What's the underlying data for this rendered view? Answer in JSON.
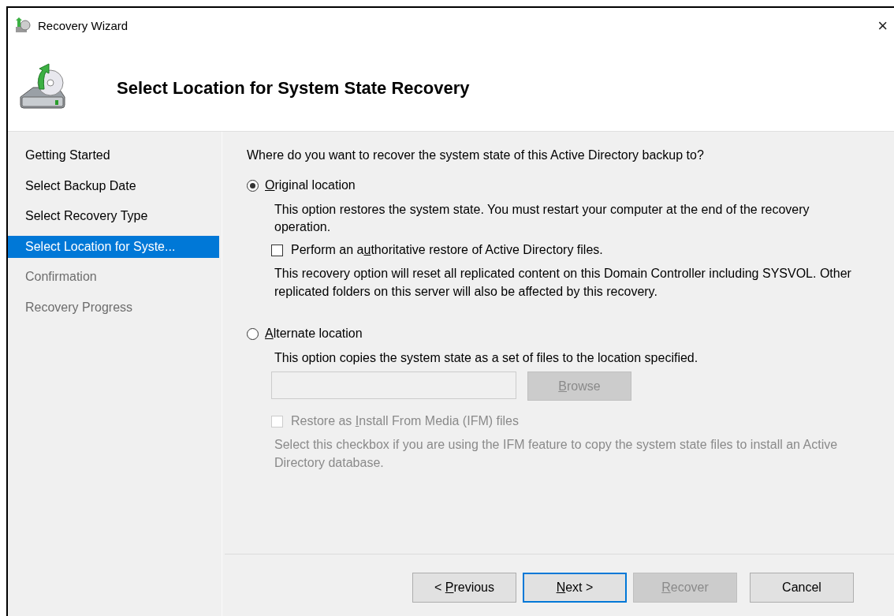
{
  "window": {
    "title": "Recovery Wizard",
    "close": "×"
  },
  "header": {
    "title": "Select Location for System State Recovery"
  },
  "steps": [
    {
      "label": "Getting Started",
      "selected": false,
      "disabled": false
    },
    {
      "label": "Select Backup Date",
      "selected": false,
      "disabled": false
    },
    {
      "label": "Select Recovery Type",
      "selected": false,
      "disabled": false
    },
    {
      "label": "Select Location for Syste...",
      "selected": true,
      "disabled": false
    },
    {
      "label": "Confirmation",
      "selected": false,
      "disabled": true
    },
    {
      "label": "Recovery Progress",
      "selected": false,
      "disabled": true
    }
  ],
  "question": "Where do you want to recover the system state of this Active Directory backup to?",
  "options": [
    {
      "key": "O",
      "post": "riginal location",
      "selected": true,
      "description": "This option restores the system state. You must restart your computer at the end of the recovery operation.",
      "checkbox": {
        "pre": "Perform an a",
        "key": "u",
        "post": "thoritative restore of Active Directory files.",
        "checked": false,
        "disabled": false,
        "note": "This recovery option will reset all replicated content on this Domain Controller including SYSVOL. Other replicated folders on this server will also be affected by this recovery."
      }
    },
    {
      "key": "A",
      "post": "lternate location",
      "selected": false,
      "description": "This option copies the system state as a set of files to the location specified.",
      "path": {
        "disabled": true,
        "browse": {
          "key": "B",
          "post": "rowse"
        }
      },
      "checkbox": {
        "pre": "Restore as ",
        "key": "I",
        "post": "nstall From Media (IFM) files",
        "checked": false,
        "disabled": true,
        "note": "Select this checkbox if you are using the IFM feature to copy the system state files to install an Active Directory database."
      }
    }
  ],
  "buttons": [
    {
      "pre": "< ",
      "key": "P",
      "post": "revious",
      "disabled": false,
      "default": false
    },
    {
      "key": "N",
      "post": "ext >",
      "disabled": false,
      "default": true
    },
    {
      "key": "R",
      "post": "ecover",
      "disabled": true,
      "default": false
    },
    {
      "pre": "Cancel",
      "disabled": false,
      "default": false
    }
  ]
}
